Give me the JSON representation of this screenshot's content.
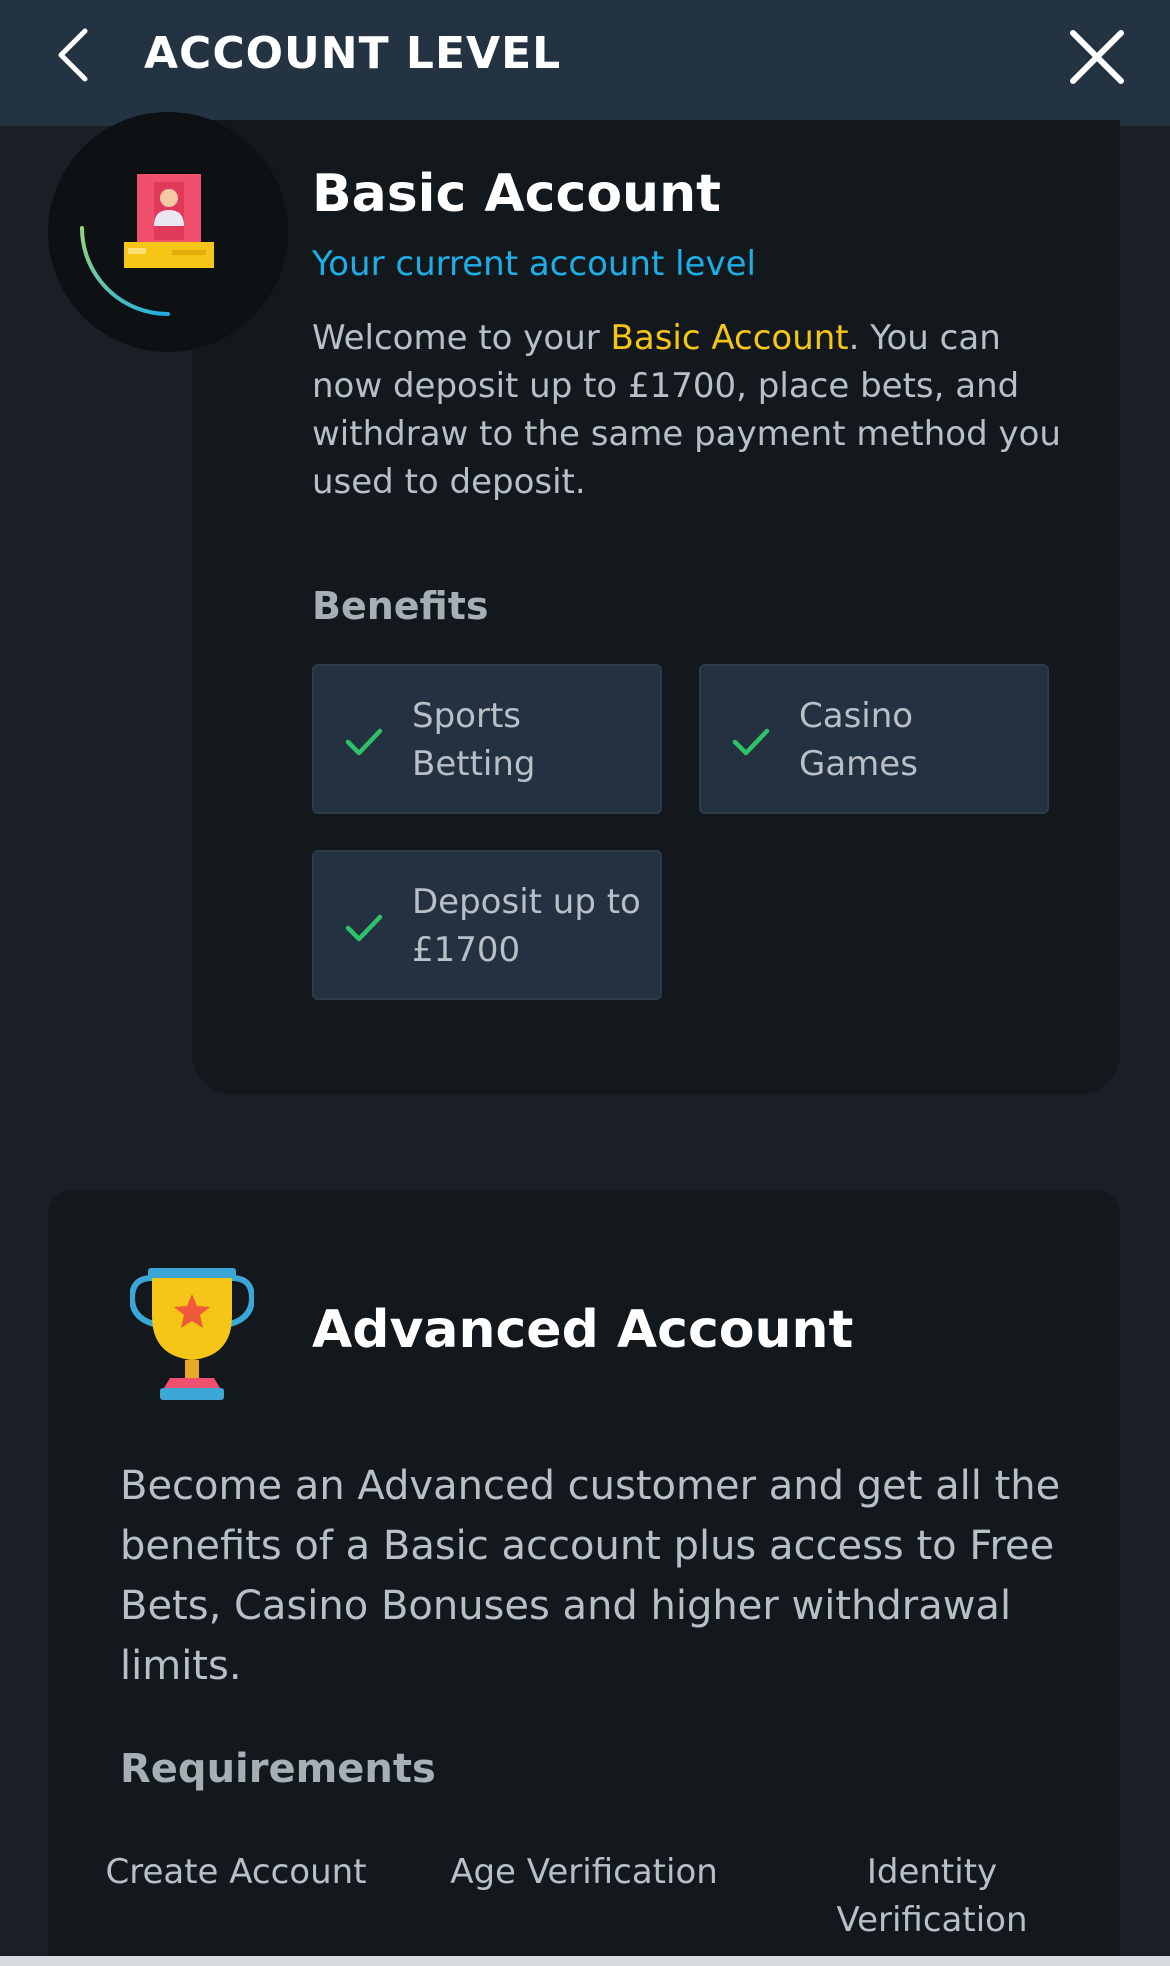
{
  "header": {
    "title": "ACCOUNT LEVEL"
  },
  "basic": {
    "title": "Basic Account",
    "subtitle": "Your current account level",
    "desc_prefix": "Welcome to your ",
    "desc_highlight": "Basic Account",
    "desc_suffix": ". You can now deposit up to £1700, place bets, and withdraw to the same payment method you used to deposit.",
    "benefits_title": "Benefits",
    "benefits": [
      {
        "label": "Sports Betting"
      },
      {
        "label": "Casino Games"
      },
      {
        "label": "Deposit up to £1700"
      }
    ]
  },
  "advanced": {
    "title": "Advanced Account",
    "desc": "Become an Advanced customer and get all the benefits of a Basic account plus access to Free Bets, Casino Bonuses and higher withdrawal limits.",
    "requirements_title": "Requirements",
    "requirements": [
      {
        "label": "Create Account"
      },
      {
        "label": "Age Verification"
      },
      {
        "label": "Identity Verification"
      }
    ]
  },
  "colors": {
    "accent": "#1eaee6",
    "highlight": "#f5c518",
    "check": "#2ec26a"
  },
  "icons": {
    "back": "chevron-left-icon",
    "close": "close-icon",
    "check": "checkmark-icon",
    "badge": "id-card-icon",
    "trophy": "trophy-icon"
  }
}
